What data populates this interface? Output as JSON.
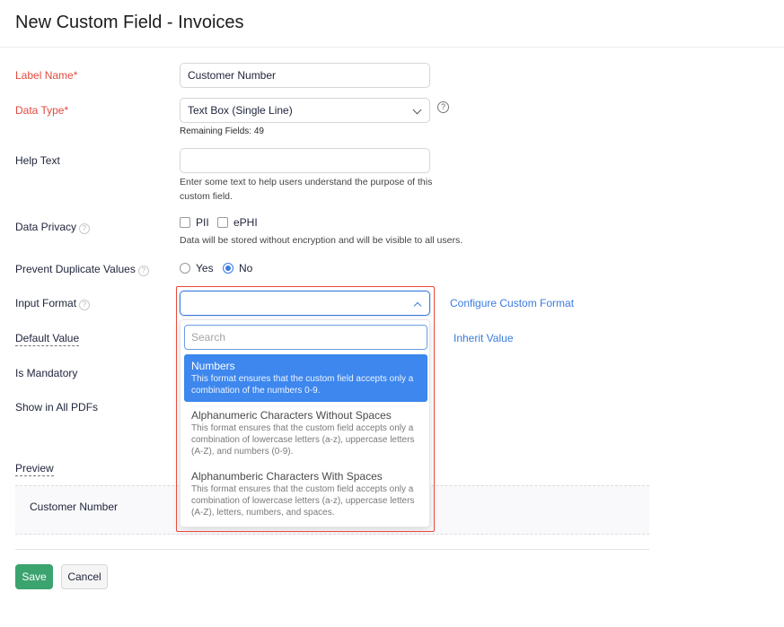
{
  "page": {
    "title": "New Custom Field - Invoices"
  },
  "form": {
    "label_name": {
      "label": "Label Name*",
      "value": "Customer Number"
    },
    "data_type": {
      "label": "Data Type*",
      "value": "Text Box (Single Line)",
      "help": "?",
      "remaining": "Remaining Fields: 49"
    },
    "help_text": {
      "label": "Help Text",
      "value": "",
      "hint": "Enter some text to help users understand the purpose of this custom field."
    },
    "data_privacy": {
      "label": "Data Privacy",
      "options": [
        "PII",
        "ePHI"
      ],
      "note": "Data will be stored without encryption and will be visible to all users."
    },
    "prevent_duplicates": {
      "label": "Prevent Duplicate Values",
      "options": [
        "Yes",
        "No"
      ],
      "selected": "No"
    },
    "input_format": {
      "label": "Input Format",
      "value": "",
      "link": "Configure Custom Format"
    },
    "default_value": {
      "label": "Default Value",
      "link": "Inherit Value"
    },
    "is_mandatory": {
      "label": "Is Mandatory"
    },
    "show_in_pdfs": {
      "label": "Show in All PDFs"
    },
    "info_glyph": "?"
  },
  "dropdown": {
    "search_placeholder": "Search",
    "options": [
      {
        "title": "Numbers",
        "desc": "This format ensures that the custom field accepts only a combination of the numbers 0-9.",
        "selected": true
      },
      {
        "title": "Alphanumeric Characters Without Spaces",
        "desc": "This format ensures that the custom field accepts only a combination of lowercase letters (a-z), uppercase letters (A-Z), and numbers (0-9).",
        "selected": false
      },
      {
        "title": "Alphanumberic Characters With Spaces",
        "desc": "This format ensures that the custom field accepts only a combination of lowercase letters (a-z), uppercase letters (A-Z), letters, numbers, and spaces.",
        "selected": false
      }
    ]
  },
  "preview": {
    "heading": "Preview",
    "field_label": "Customer Number"
  },
  "actions": {
    "save": "Save",
    "cancel": "Cancel"
  },
  "colors": {
    "accent": "#3a7be0",
    "required": "#e34a3f",
    "save": "#3ba36e",
    "highlight": "#e84a3a"
  }
}
